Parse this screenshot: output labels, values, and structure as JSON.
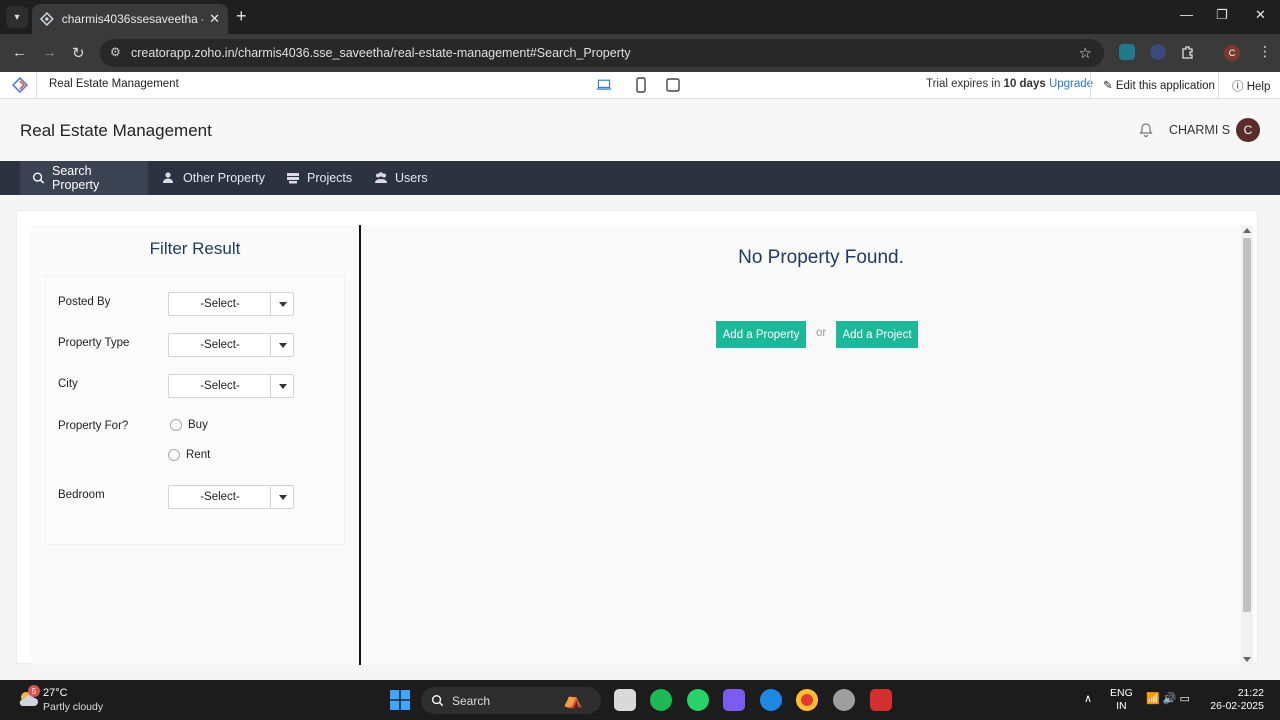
{
  "browser": {
    "tab_title": "charmis4036ssesaveetha - Real",
    "url": "creatorapp.zoho.in/charmis4036.sse_saveetha/real-estate-management#Search_Property",
    "minimize": "—",
    "maximize": "❐",
    "close": "✕",
    "new_tab": "+",
    "back": "←",
    "forward": "→",
    "reload": "↻",
    "profile_initial": "C"
  },
  "zoho_bar": {
    "app_name": "Real Estate Management",
    "trial_prefix": "Trial expires in ",
    "trial_days": "10 days",
    "upgrade": "Upgrade",
    "edit_app": "Edit this application",
    "help": "Help"
  },
  "app_header": {
    "title": "Real Estate Management",
    "user_name": "CHARMI S",
    "user_initial": "C"
  },
  "nav": {
    "items": [
      {
        "label": "Search Property"
      },
      {
        "label": "Other Property"
      },
      {
        "label": "Projects"
      },
      {
        "label": "Users"
      }
    ]
  },
  "filter": {
    "title": "Filter Result",
    "posted_by_label": "Posted By",
    "property_type_label": "Property Type",
    "city_label": "City",
    "property_for_label": "Property For?",
    "bedroom_label": "Bedroom",
    "select_placeholder": "-Select-",
    "buy_label": "Buy",
    "rent_label": "Rent"
  },
  "results": {
    "message": "No Property Found.",
    "add_property": "Add a Property",
    "or_text": "or",
    "add_project": "Add a Project"
  },
  "taskbar": {
    "weather_badge": "5",
    "temperature": "27°C",
    "condition": "Partly cloudy",
    "search_label": "Search",
    "lang_1": "ENG",
    "lang_2": "IN",
    "time": "21:22",
    "date": "26-02-2025"
  },
  "colors": {
    "accent_green": "#1bb99a",
    "nav_bg": "#2c3240",
    "heading_blue": "#1f3a5c",
    "upgrade_link": "#2a78d6"
  }
}
